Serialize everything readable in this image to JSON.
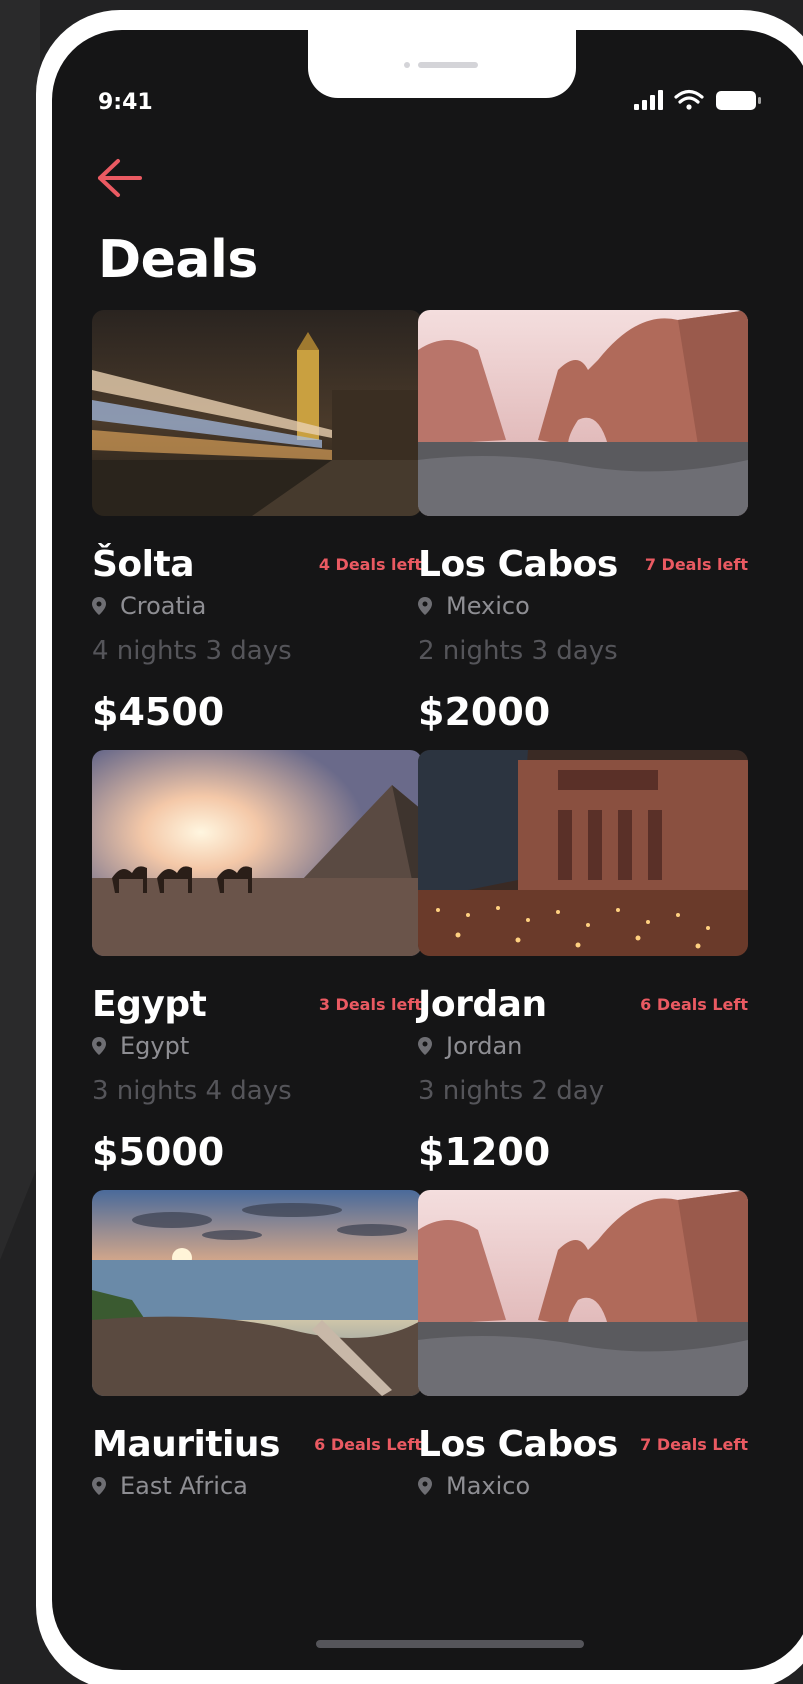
{
  "status_bar": {
    "time": "9:41"
  },
  "page": {
    "title": "Deals"
  },
  "colors": {
    "accent": "#ea5a62",
    "background": "#151516",
    "frame": "#ffffff"
  },
  "icons": {
    "back": "arrow-left-icon",
    "location": "location-pin-icon",
    "signal": "signal-icon",
    "wifi": "wifi-icon",
    "battery": "battery-icon"
  },
  "deals": [
    {
      "name": "Šolta",
      "deals_left": "4 Deals left",
      "location": "Croatia",
      "duration": "4 nights 3 days",
      "price": "$4500",
      "image": "london-night"
    },
    {
      "name": "Los Cabos",
      "deals_left": "7 Deals left",
      "location": "Mexico",
      "duration": "2 nights 3 days",
      "price": "$2000",
      "image": "arch-rock"
    },
    {
      "name": "Egypt",
      "deals_left": "3 Deals left",
      "location": "Egypt",
      "duration": "3 nights 4 days",
      "price": "$5000",
      "image": "pyramid-camels"
    },
    {
      "name": "Jordan",
      "deals_left": "6 Deals Left",
      "location": "Jordan",
      "duration": "3 nights 2 day",
      "price": "$1200",
      "image": "petra-candles"
    },
    {
      "name": "Mauritius",
      "deals_left": "6 Deals Left",
      "location": "East Africa",
      "duration": "",
      "price": "",
      "image": "beach-sunset"
    },
    {
      "name": "Los Cabos",
      "deals_left": "7 Deals Left",
      "location": "Maxico",
      "duration": "",
      "price": "",
      "image": "arch-rock"
    }
  ]
}
